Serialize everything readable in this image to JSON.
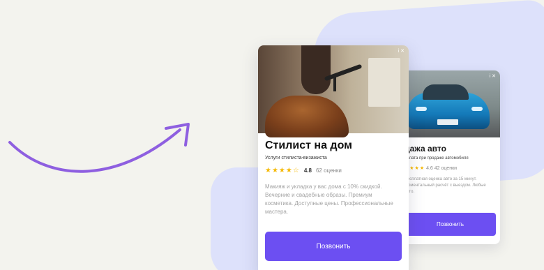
{
  "colors": {
    "background": "#f3f3ee",
    "blob": "#dde1fb",
    "accent": "#6c4ff2",
    "arrow": "#8e5fe0",
    "star": "#f5b800"
  },
  "front_card": {
    "ad_mark": "i ✕",
    "image_icon": "hair-stylist-photo",
    "title": "Стилист на дом",
    "subtitle": "Услуги стилиста-визажиста",
    "rating_stars": "★★★★☆",
    "rating_value": "4.8",
    "rating_count": "62 оценки",
    "description": "Макияж и укладка у вас дома с 10% скидкой. Вечерние и свадебные образы. Премиум косметика. Доступные цены. Профессиональные мастера.",
    "button_label": "Позвонить"
  },
  "back_card": {
    "ad_mark": "i ✕",
    "image_icon": "blue-car-photo",
    "title": "дажа авто",
    "subtitle": "оплата при продаже автомобиля",
    "rating_stars": "★★★★",
    "rating_value": "4.6",
    "rating_count": "42 оценки",
    "description": "Бесплатная оценка авто за 15 минут. Моментальный расчёт с выездом. Любые авто.",
    "button_label": "Позвонить"
  },
  "arrow_icon": "curved-arrow-icon"
}
